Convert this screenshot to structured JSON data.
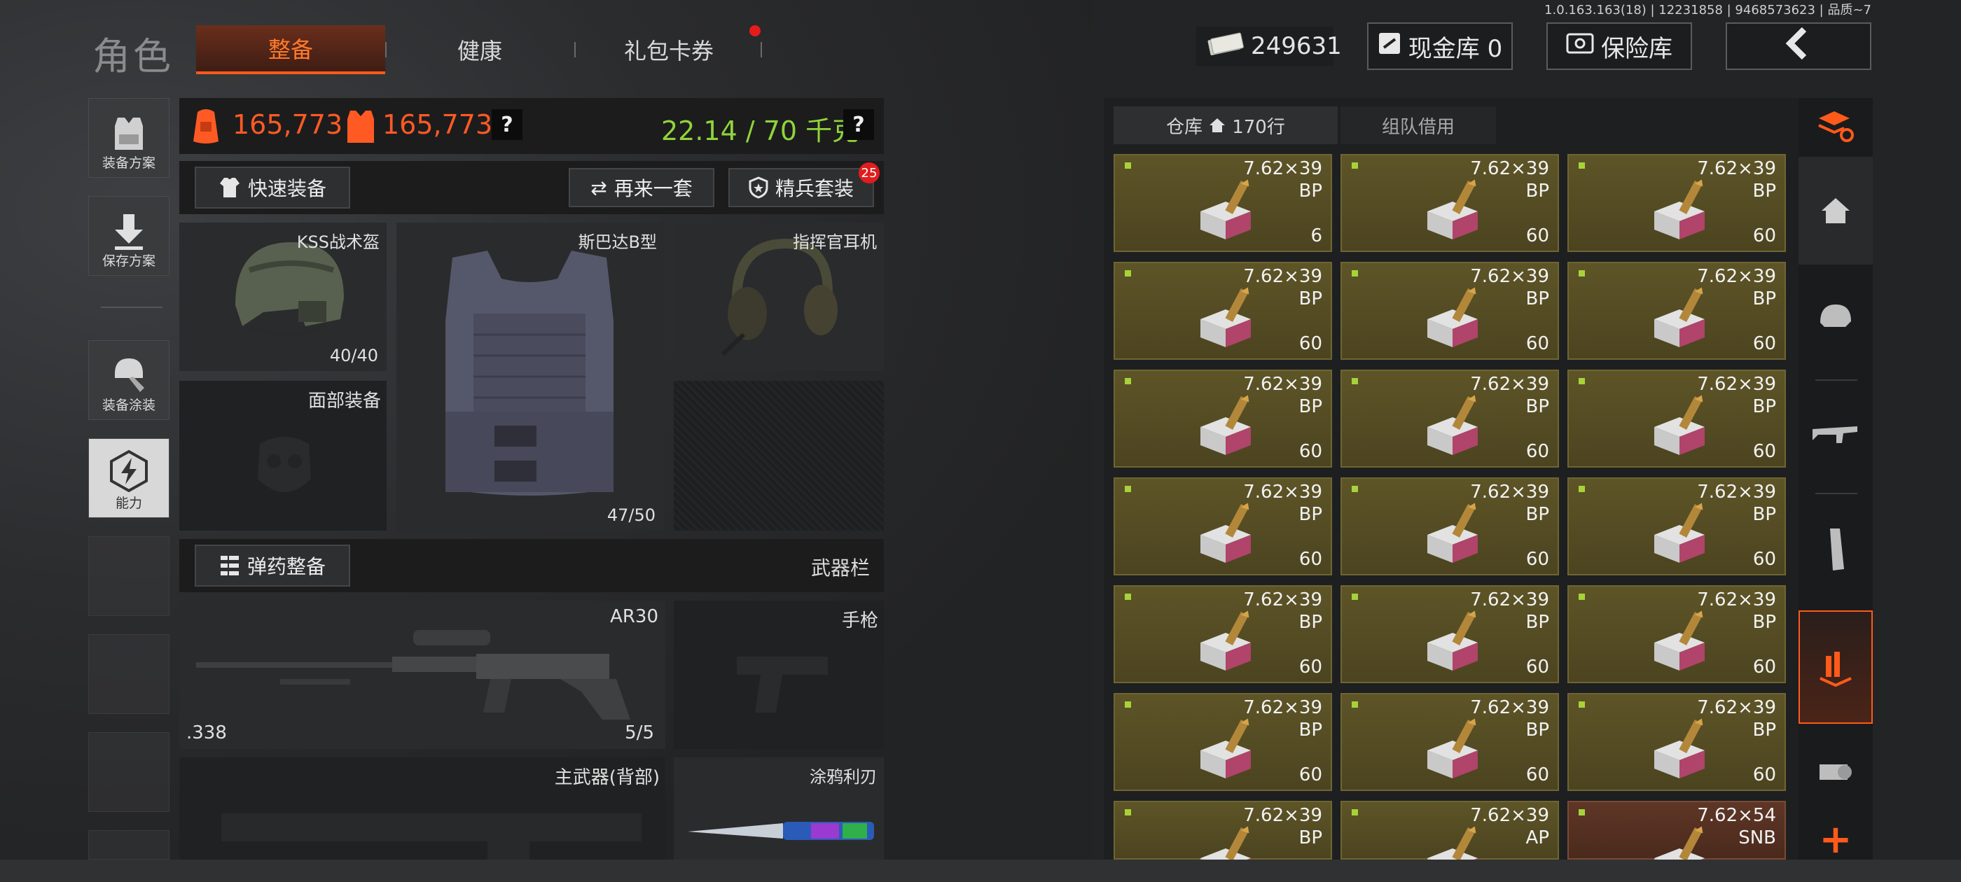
{
  "build_info": "1.0.163.163(18) | 12231858 | 9468573623 | 品质~7",
  "app_title": "角色",
  "tabs": [
    {
      "label": "整备",
      "active": true
    },
    {
      "label": "健康",
      "active": false
    },
    {
      "label": "礼包卡券",
      "active": false
    }
  ],
  "money": {
    "value": "249631",
    "icon": "cash-icon"
  },
  "top_buttons": {
    "cash_vault": "现金库 0",
    "safe_vault": "保险库",
    "back": "back-arrow-icon"
  },
  "left_menu": [
    {
      "label": "装备方案",
      "icon": "vest-icon"
    },
    {
      "label": "保存方案",
      "icon": "download-icon"
    },
    {
      "label": "装备涂装",
      "icon": "helmet-paint-icon"
    },
    {
      "label": "能力",
      "icon": "lightning-hex-icon"
    }
  ],
  "stats": {
    "value_a": "165,773",
    "value_b": "165,773",
    "weight": "22.14 / 70 千克",
    "help": "?"
  },
  "equip_buttons": {
    "quick_equip": "快速装备",
    "again": "再来一套",
    "elite": "精兵套装",
    "elite_badge": "25"
  },
  "slots": {
    "helmet": {
      "label": "KSS战术盔",
      "durability": "40/40"
    },
    "armor": {
      "label": "斯巴达B型",
      "durability": "47/50"
    },
    "headset": {
      "label": "指挥官耳机"
    },
    "face": {
      "label": "面部装备"
    }
  },
  "ammo_equip_button": "弹药整备",
  "weapon_bar_label": "武器栏",
  "weapons": {
    "primary": {
      "name": "AR30",
      "caliber": ".338",
      "ammo": "5/5"
    },
    "pistol": {
      "label": "手枪"
    },
    "back_primary": {
      "label": "主武器(背部)"
    },
    "melee": {
      "label": "涂鸦利刃"
    }
  },
  "inventory": {
    "tab_storage": "仓库",
    "tab_storage_rows": "170行",
    "tab_team": "组队借用",
    "items": [
      {
        "cal": "7.62×39",
        "type": "BP",
        "qty": "6",
        "color": "olive"
      },
      {
        "cal": "7.62×39",
        "type": "BP",
        "qty": "60",
        "color": "olive"
      },
      {
        "cal": "7.62×39",
        "type": "BP",
        "qty": "60",
        "color": "olive"
      },
      {
        "cal": "7.62×39",
        "type": "BP",
        "qty": "60",
        "color": "olive"
      },
      {
        "cal": "7.62×39",
        "type": "BP",
        "qty": "60",
        "color": "olive"
      },
      {
        "cal": "7.62×39",
        "type": "BP",
        "qty": "60",
        "color": "olive"
      },
      {
        "cal": "7.62×39",
        "type": "BP",
        "qty": "60",
        "color": "olive"
      },
      {
        "cal": "7.62×39",
        "type": "BP",
        "qty": "60",
        "color": "olive"
      },
      {
        "cal": "7.62×39",
        "type": "BP",
        "qty": "60",
        "color": "olive"
      },
      {
        "cal": "7.62×39",
        "type": "BP",
        "qty": "60",
        "color": "olive"
      },
      {
        "cal": "7.62×39",
        "type": "BP",
        "qty": "60",
        "color": "olive"
      },
      {
        "cal": "7.62×39",
        "type": "BP",
        "qty": "60",
        "color": "olive"
      },
      {
        "cal": "7.62×39",
        "type": "BP",
        "qty": "60",
        "color": "olive"
      },
      {
        "cal": "7.62×39",
        "type": "BP",
        "qty": "60",
        "color": "olive"
      },
      {
        "cal": "7.62×39",
        "type": "BP",
        "qty": "60",
        "color": "olive"
      },
      {
        "cal": "7.62×39",
        "type": "BP",
        "qty": "60",
        "color": "olive"
      },
      {
        "cal": "7.62×39",
        "type": "BP",
        "qty": "60",
        "color": "olive"
      },
      {
        "cal": "7.62×39",
        "type": "BP",
        "qty": "60",
        "color": "olive"
      },
      {
        "cal": "7.62×39",
        "type": "BP",
        "qty": "",
        "color": "olive"
      },
      {
        "cal": "7.62×39",
        "type": "AP",
        "qty": "",
        "color": "olive"
      },
      {
        "cal": "7.62×54",
        "type": "SNB",
        "qty": "",
        "color": "red"
      }
    ]
  },
  "right_sidebar": [
    "sort-layers-icon",
    "home-icon",
    "helmet-icon",
    "rifle-icon",
    "magazine-icon",
    "ammo-icon",
    "scope-icon",
    "add-icon"
  ],
  "colors": {
    "accent": "#ff5a1a",
    "weight_green": "#8fd43a",
    "stat_orange": "#ff5a24"
  }
}
